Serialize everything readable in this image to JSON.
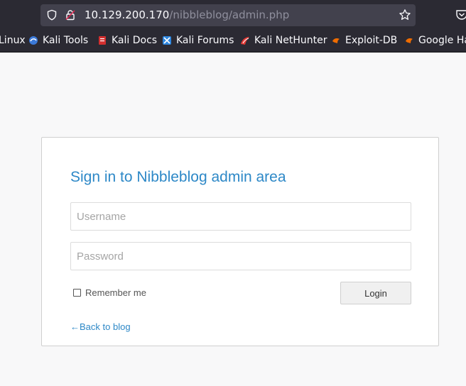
{
  "browser": {
    "url_host": "10.129.200.170",
    "url_path": "/nibbleblog/admin.php"
  },
  "bookmarks": [
    {
      "label": "Linux",
      "icon": "kali-linux-icon"
    },
    {
      "label": "Kali Tools",
      "icon": "kali-tools-icon"
    },
    {
      "label": "Kali Docs",
      "icon": "kali-docs-icon"
    },
    {
      "label": "Kali Forums",
      "icon": "kali-forums-icon"
    },
    {
      "label": "Kali NetHunter",
      "icon": "kali-nethunter-icon"
    },
    {
      "label": "Exploit-DB",
      "icon": "exploit-db-icon"
    },
    {
      "label": "Google Ha",
      "icon": "google-hacking-icon"
    }
  ],
  "login": {
    "title": "Sign in to Nibbleblog admin area",
    "username_placeholder": "Username",
    "password_placeholder": "Password",
    "remember_label": "Remember me",
    "login_label": "Login",
    "back_label": "←Back to blog"
  },
  "colors": {
    "accent": "#2d88c7",
    "chrome_bg": "#2b2a33",
    "urlbar_bg": "#42414d"
  }
}
